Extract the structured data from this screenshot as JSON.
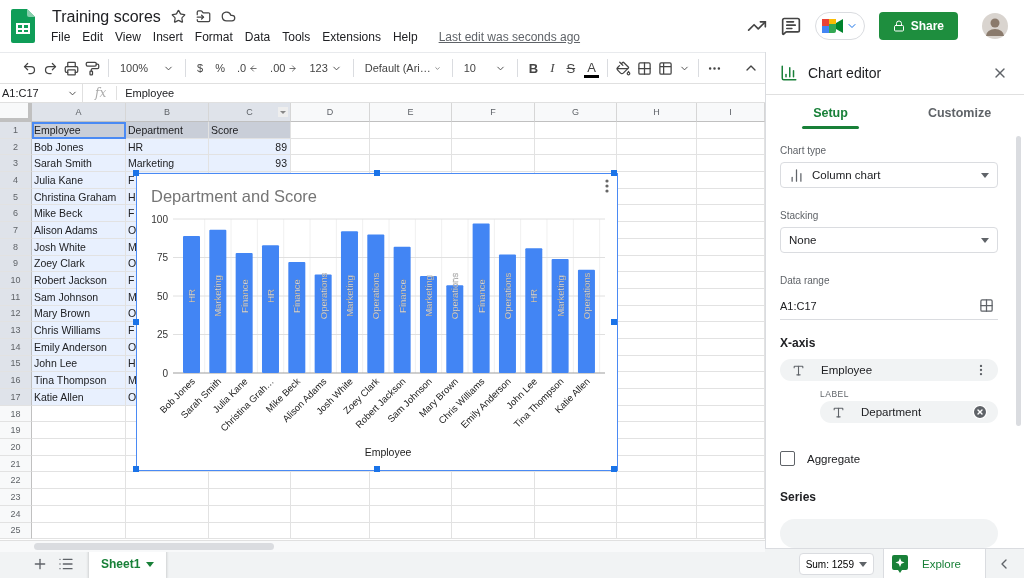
{
  "document": {
    "title": "Training scores",
    "last_edit": "Last edit was seconds ago"
  },
  "menu": [
    "File",
    "Edit",
    "View",
    "Insert",
    "Format",
    "Data",
    "Tools",
    "Extensions",
    "Help"
  ],
  "share_button": "Share",
  "toolbar": {
    "zoom": "100%",
    "currency": "$",
    "percent": "%",
    "decrease_decimals": ".0",
    "increase_decimals": ".00",
    "number_format": "123",
    "font": "Default (Ari…",
    "font_size": "10",
    "bold": "B",
    "italic": "I",
    "strikethrough": "S",
    "text_color": "A"
  },
  "formula_bar": {
    "range": "A1:C17",
    "fx": "fx",
    "content": "Employee"
  },
  "sheet": {
    "columns": [
      {
        "label": "A",
        "selected": true,
        "active": true,
        "menu": false
      },
      {
        "label": "B",
        "selected": true,
        "active": false,
        "menu": false
      },
      {
        "label": "C",
        "selected": true,
        "active": false,
        "menu": true
      },
      {
        "label": "D",
        "selected": false,
        "active": false,
        "menu": false
      },
      {
        "label": "E",
        "selected": false,
        "active": false,
        "menu": false
      },
      {
        "label": "F",
        "selected": false,
        "active": false,
        "menu": false
      },
      {
        "label": "G",
        "selected": false,
        "active": false,
        "menu": false
      },
      {
        "label": "H",
        "selected": false,
        "active": false,
        "menu": false
      },
      {
        "label": "I",
        "selected": false,
        "active": false,
        "menu": false
      }
    ],
    "rows": [
      {
        "number": "1",
        "selected": true,
        "active": true,
        "cells": [
          {
            "text": "Employee",
            "kind": "heading"
          },
          {
            "text": "Department",
            "kind": "heading"
          },
          {
            "text": "Score",
            "kind": "heading"
          }
        ]
      },
      {
        "number": "2",
        "selected": true,
        "active": false,
        "cells": [
          {
            "text": "Bob Jones",
            "kind": "text"
          },
          {
            "text": "HR",
            "kind": "text"
          },
          {
            "text": "89",
            "kind": "number"
          }
        ]
      },
      {
        "number": "3",
        "selected": true,
        "active": false,
        "cells": [
          {
            "text": "Sarah Smith",
            "kind": "text"
          },
          {
            "text": "Marketing",
            "kind": "text"
          },
          {
            "text": "93",
            "kind": "number"
          }
        ]
      },
      {
        "number": "4",
        "selected": true,
        "active": false,
        "cells": [
          {
            "text": "Julia Kane",
            "kind": "text"
          },
          {
            "text": "F",
            "kind": "text"
          }
        ]
      },
      {
        "number": "5",
        "selected": true,
        "active": false,
        "cells": [
          {
            "text": "Christina Graham",
            "kind": "text"
          },
          {
            "text": "H",
            "kind": "text"
          }
        ]
      },
      {
        "number": "6",
        "selected": true,
        "active": false,
        "cells": [
          {
            "text": "Mike Beck",
            "kind": "text"
          },
          {
            "text": "F",
            "kind": "text"
          }
        ]
      },
      {
        "number": "7",
        "selected": true,
        "active": false,
        "cells": [
          {
            "text": "Alison Adams",
            "kind": "text"
          },
          {
            "text": "O",
            "kind": "text"
          }
        ]
      },
      {
        "number": "8",
        "selected": true,
        "active": false,
        "cells": [
          {
            "text": "Josh White",
            "kind": "text"
          },
          {
            "text": "M",
            "kind": "text"
          }
        ]
      },
      {
        "number": "9",
        "selected": true,
        "active": false,
        "cells": [
          {
            "text": "Zoey Clark",
            "kind": "text"
          },
          {
            "text": "O",
            "kind": "text"
          }
        ]
      },
      {
        "number": "10",
        "selected": true,
        "active": false,
        "cells": [
          {
            "text": "Robert Jackson",
            "kind": "text"
          },
          {
            "text": "F",
            "kind": "text"
          }
        ]
      },
      {
        "number": "11",
        "selected": true,
        "active": false,
        "cells": [
          {
            "text": "Sam Johnson",
            "kind": "text"
          },
          {
            "text": "M",
            "kind": "text"
          }
        ]
      },
      {
        "number": "12",
        "selected": true,
        "active": false,
        "cells": [
          {
            "text": "Mary Brown",
            "kind": "text"
          },
          {
            "text": "O",
            "kind": "text"
          }
        ]
      },
      {
        "number": "13",
        "selected": true,
        "active": false,
        "cells": [
          {
            "text": "Chris Williams",
            "kind": "text"
          },
          {
            "text": "F",
            "kind": "text"
          }
        ]
      },
      {
        "number": "14",
        "selected": true,
        "active": false,
        "cells": [
          {
            "text": "Emily Anderson",
            "kind": "text"
          },
          {
            "text": "O",
            "kind": "text"
          }
        ]
      },
      {
        "number": "15",
        "selected": true,
        "active": false,
        "cells": [
          {
            "text": "John Lee",
            "kind": "text"
          },
          {
            "text": "H",
            "kind": "text"
          }
        ]
      },
      {
        "number": "16",
        "selected": true,
        "active": false,
        "cells": [
          {
            "text": "Tina Thompson",
            "kind": "text"
          },
          {
            "text": "M",
            "kind": "text"
          }
        ]
      },
      {
        "number": "17",
        "selected": true,
        "active": false,
        "cells": [
          {
            "text": "Katie Allen",
            "kind": "text"
          },
          {
            "text": "O",
            "kind": "text"
          }
        ]
      },
      {
        "number": "18",
        "selected": false,
        "active": false
      },
      {
        "number": "19",
        "selected": false,
        "active": false
      },
      {
        "number": "20",
        "selected": false,
        "active": false
      },
      {
        "number": "21",
        "selected": false,
        "active": false
      },
      {
        "number": "22",
        "selected": false,
        "active": false
      },
      {
        "number": "23",
        "selected": false,
        "active": false
      },
      {
        "number": "24",
        "selected": false,
        "active": false
      },
      {
        "number": "25",
        "selected": false,
        "active": false
      }
    ],
    "chart": {
      "chart_data": {
        "type": "bar",
        "title": "Department  and Score",
        "xlabel": "Employee",
        "categories": [
          "Bob Jones",
          "Sarah Smith",
          "Julia Kane",
          "Christina Grah…",
          "Mike Beck",
          "Alison Adams",
          "Josh White",
          "Zoey Clark",
          "Robert Jackson",
          "Sam Johnson",
          "Mary Brown",
          "Chris Williams",
          "Emily Anderson",
          "John Lee",
          "Tina Thompson",
          "Katie Allen"
        ],
        "grid": true,
        "series": [
          {
            "color": "#4285f4",
            "values": [
              89,
              93,
              78,
              83,
              72,
              64,
              92,
              90,
              82,
              63,
              57,
              97,
              77,
              81,
              74,
              67
            ]
          }
        ],
        "ylim": [
          0,
          100
        ],
        "yticks": [
          0,
          25,
          50,
          75,
          100
        ],
        "value_labels": [
          "HR",
          "Marketing",
          "Finance",
          "HR",
          "Finance",
          "Operations",
          "Marketing",
          "Operations",
          "Finance",
          "Marketing",
          "Operations",
          "Finance",
          "Operations",
          "HR",
          "Marketing",
          "Operations"
        ]
      }
    }
  },
  "chart_editor": {
    "title": "Chart editor",
    "tabs": [
      {
        "label": "Setup",
        "selected": true
      },
      {
        "label": "Customize",
        "selected": false
      }
    ],
    "chart_type": {
      "label": "Chart type",
      "value": "Column chart"
    },
    "stacking": {
      "label": "Stacking",
      "value": "None"
    },
    "data_range": {
      "label": "Data range",
      "value": "A1:C17"
    },
    "x_axis": {
      "heading": "X-axis",
      "field": "Employee",
      "label_heading": "LABEL",
      "label_field": "Department"
    },
    "aggregate": {
      "label": "Aggregate",
      "checked": false
    },
    "series_heading": "Series"
  },
  "bottom_bar": {
    "sheets": [
      {
        "label": "Sheet1",
        "selected": true
      }
    ],
    "sum": "Sum: 1259",
    "explore": "Explore"
  }
}
